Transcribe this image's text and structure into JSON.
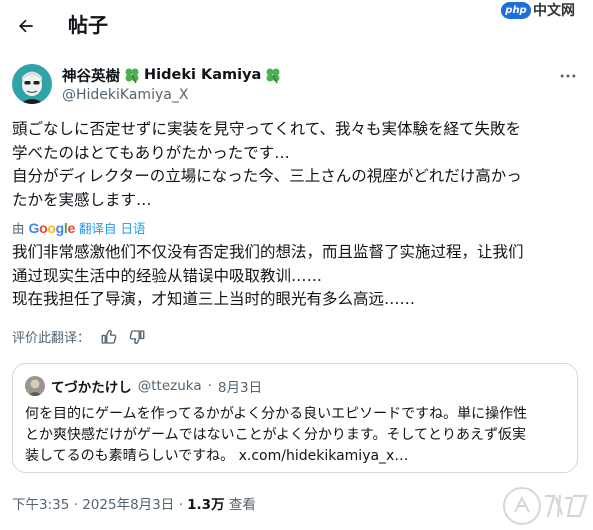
{
  "header": {
    "title": "帖子"
  },
  "watermark": {
    "logo": "php",
    "text": "中文网"
  },
  "tweet": {
    "display_name": "神谷英樹",
    "display_name_en": "Hideki Kamiya",
    "handle": "@HidekiKamiya_X",
    "original_lines": [
      "頭ごなしに否定せずに実装を見守ってくれて、我々も実体験を経て失敗を",
      "学べたのはとてもありがたかったです…",
      "自分がディレクターの立場になった今、三上さんの視座がどれだけ高かっ",
      "たかを実感します…"
    ],
    "translate_by": "由",
    "translate_provider": "Google",
    "translate_link": "翻译自 日语",
    "translated_lines": [
      "我们非常感激他们不仅没有否定我们的想法，而且监督了实施过程，让我们",
      "通过现实生活中的经验从错误中吸取教训……",
      "现在我担任了导演，才知道三上当时的眼光有多么高远……"
    ],
    "rate_label": "评价此翻译：",
    "quoted": {
      "name": "てづかたけし",
      "handle": "@ttezuka",
      "date": "8月3日",
      "lines": [
        "何を目的にゲームを作ってるかがよく分かる良いエピソードですね。単に操作性",
        "とか爽快感だけがゲームではないことがよく分かります。そしてとりあえず仮実",
        "装してるのも素晴らしいですね。 x.com/hidekikamiya_x…"
      ]
    },
    "time": "下午3:35",
    "date": "2025年8月3日",
    "views": "1.3万",
    "views_label": "查看"
  },
  "colors": {
    "text": "#0f1419",
    "secondary": "#536471",
    "accent": "#1d9bf0",
    "border": "#cfd9de",
    "clover": "#4caf50"
  }
}
